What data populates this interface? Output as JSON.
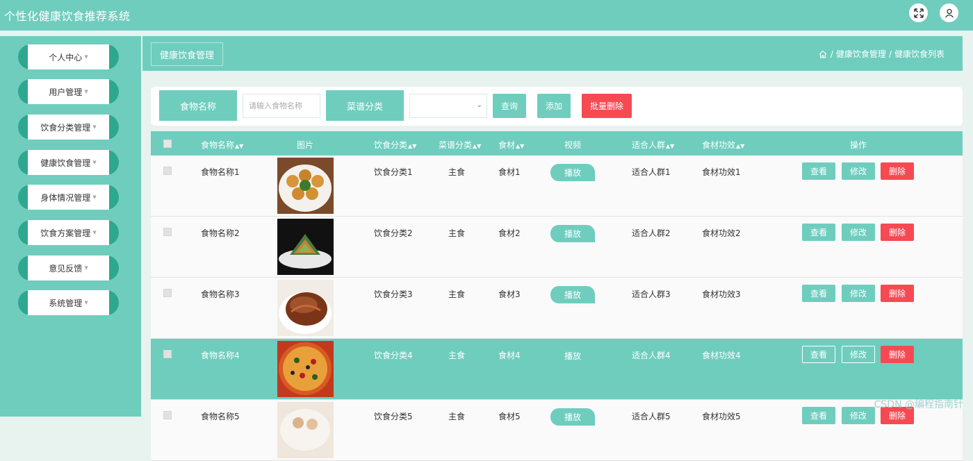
{
  "app": {
    "title": "个性化健康饮食推荐系统"
  },
  "header": {
    "icons": [
      "fullscreen-icon",
      "user-icon"
    ]
  },
  "sidebar": {
    "items": [
      {
        "label": "个人中心"
      },
      {
        "label": "用户管理"
      },
      {
        "label": "饮食分类管理"
      },
      {
        "label": "健康饮食管理"
      },
      {
        "label": "身体情况管理"
      },
      {
        "label": "饮食方案管理"
      },
      {
        "label": "意见反馈"
      },
      {
        "label": "系统管理"
      }
    ]
  },
  "breadcrumb": {
    "page_title": "健康饮食管理",
    "sep": "/",
    "path": [
      "健康饮食管理",
      "健康饮食列表"
    ]
  },
  "search": {
    "food_name_label": "食物名称",
    "food_name_placeholder": "请输入食物名称",
    "category_label": "菜谱分类",
    "category_value": "",
    "query_button": "查询",
    "add_button": "添加",
    "batch_delete_button": "批量删除"
  },
  "table": {
    "headers": [
      "食物名称",
      "图片",
      "饮食分类",
      "菜谱分类",
      "食材",
      "视频",
      "适合人群",
      "食材功效",
      "操作"
    ],
    "play_label": "播放",
    "view_label": "查看",
    "edit_label": "修改",
    "delete_label": "删除",
    "rows": [
      {
        "name": "食物名称1",
        "diet_cat": "饮食分类1",
        "menu_cat": "主食",
        "ingredient": "食材1",
        "crowd": "适合人群1",
        "effect": "食材功效1",
        "highlighted": false
      },
      {
        "name": "食物名称2",
        "diet_cat": "饮食分类2",
        "menu_cat": "主食",
        "ingredient": "食材2",
        "crowd": "适合人群2",
        "effect": "食材功效2",
        "highlighted": false
      },
      {
        "name": "食物名称3",
        "diet_cat": "饮食分类3",
        "menu_cat": "主食",
        "ingredient": "食材3",
        "crowd": "适合人群3",
        "effect": "食材功效3",
        "highlighted": false
      },
      {
        "name": "食物名称4",
        "diet_cat": "饮食分类4",
        "menu_cat": "主食",
        "ingredient": "食材4",
        "crowd": "适合人群4",
        "effect": "食材功效4",
        "highlighted": true
      },
      {
        "name": "食物名称5",
        "diet_cat": "饮食分类5",
        "menu_cat": "主食",
        "ingredient": "食材5",
        "crowd": "适合人群5",
        "effect": "食材功效5",
        "highlighted": false
      }
    ]
  },
  "watermark": "CSDN @编程指南针",
  "colors": {
    "primary": "#6fcdbe",
    "danger": "#f64a52",
    "sidebar_accent": "#2ea78f"
  }
}
